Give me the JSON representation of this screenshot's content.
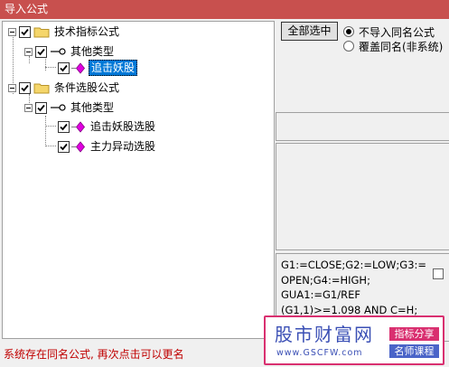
{
  "window": {
    "title": "导入公式"
  },
  "tree": {
    "nodes": [
      {
        "label": "技术指标公式"
      },
      {
        "label": "其他类型"
      },
      {
        "label": "追击妖股"
      },
      {
        "label": "条件选股公式"
      },
      {
        "label": "其他类型"
      },
      {
        "label": "追击妖股选股"
      },
      {
        "label": "主力异动选股"
      }
    ]
  },
  "controls": {
    "select_all_label": "全部选中",
    "radio_no_import": "不导入同名公式",
    "radio_overwrite": "覆盖同名(非系统)"
  },
  "formula_preview": {
    "lines": [
      "G1:=CLOSE;G2:=LOW;G3:=",
      "OPEN;G4:=HIGH;",
      "GUA1:=G1/REF",
      "(G1,1)>=1.098 AND C=H;"
    ]
  },
  "status": {
    "text": "系统存在同名公式, 再次点击可以更名"
  },
  "watermark": {
    "brand": "股市财富网",
    "url": "www.GSCFW.com",
    "tag1": "指标分享",
    "tag2": "名师课程"
  },
  "colors": {
    "titlebar": "#c8504e",
    "selection": "#0078d7",
    "status_text": "#c00000",
    "formula_icon": "#e000e0"
  }
}
